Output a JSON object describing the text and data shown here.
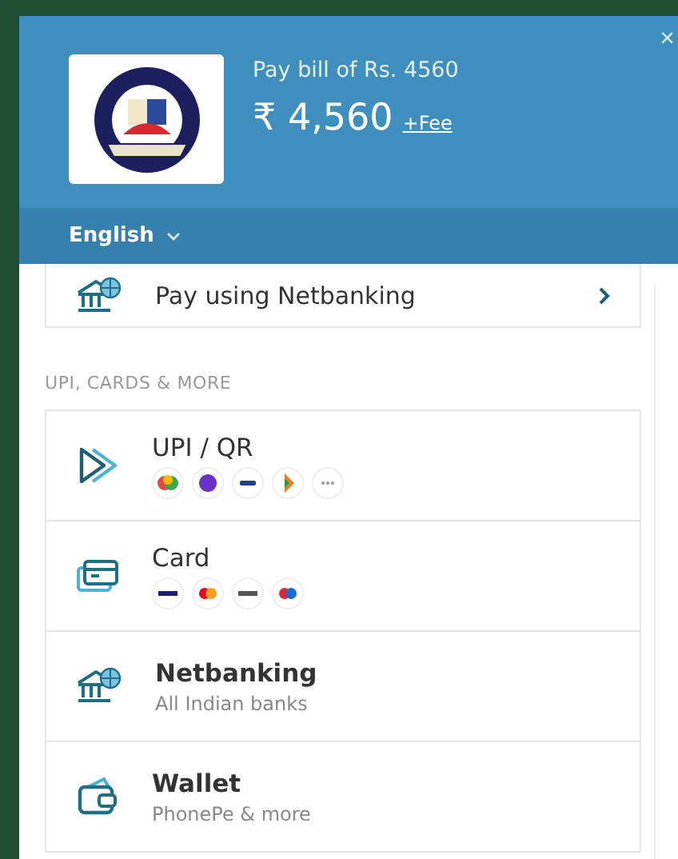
{
  "header": {
    "bill_text": "Pay bill of Rs. 4560",
    "amount": "₹ 4,560",
    "fee_link": "+Fee",
    "close": "×",
    "language": "English"
  },
  "netbanking_row": {
    "label": "Pay using Netbanking"
  },
  "section_title": "UPI, CARDS & MORE",
  "methods": [
    {
      "kind": "upi",
      "title": "UPI / QR"
    },
    {
      "kind": "card",
      "title": "Card"
    },
    {
      "kind": "netbanking",
      "title": "Netbanking",
      "subtitle": "All Indian banks"
    },
    {
      "kind": "wallet",
      "title": "Wallet",
      "subtitle": "PhonePe & more"
    }
  ]
}
